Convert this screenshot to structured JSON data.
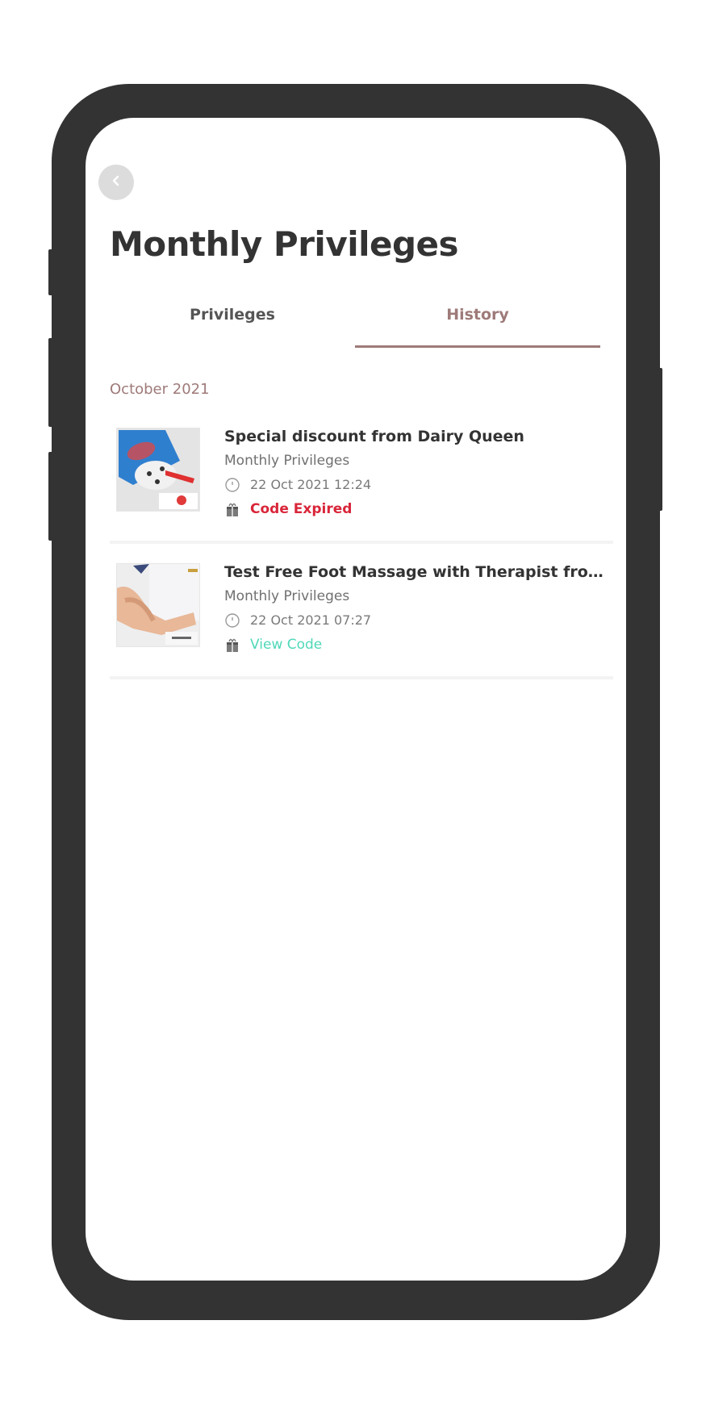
{
  "header": {
    "back_icon": "chevron-left-icon",
    "title": "Monthly Privileges"
  },
  "tabs": [
    {
      "label": "Privileges",
      "active": false
    },
    {
      "label": "History",
      "active": true
    }
  ],
  "colors": {
    "accent": "#9e7a79",
    "expired": "#d9263a",
    "view_code": "#4fd8b8",
    "frame": "#333333"
  },
  "history": {
    "month": "October 2021",
    "items": [
      {
        "title": "Special discount from Dairy Queen",
        "category": "Monthly Privileges",
        "datetime": "22 Oct 2021 12:24",
        "status": "Code Expired",
        "status_type": "expired",
        "image": "dairy-queen-blizzard-image"
      },
      {
        "title": "Test Free Foot Massage with Therapist from...",
        "category": "Monthly Privileges",
        "datetime": "22 Oct 2021 07:27",
        "status": "View Code",
        "status_type": "view",
        "image": "foot-massage-image"
      }
    ]
  }
}
